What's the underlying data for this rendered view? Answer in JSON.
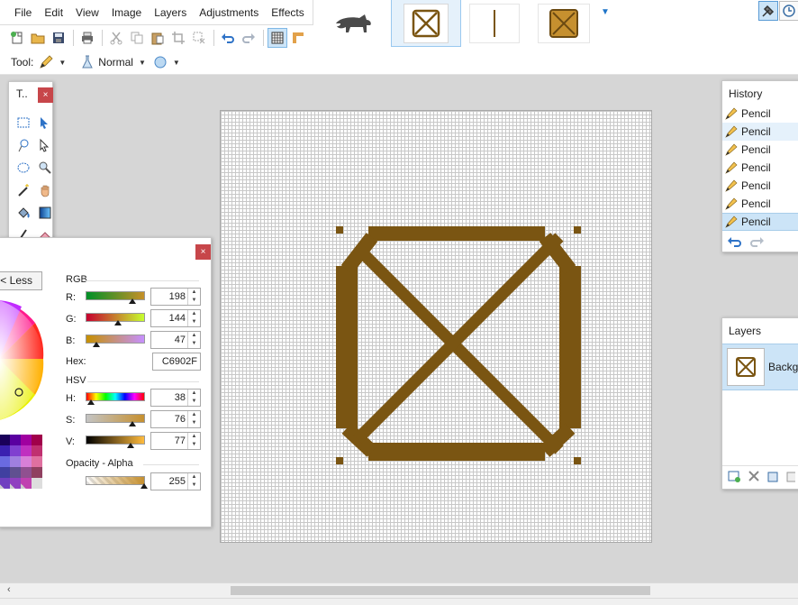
{
  "menu": [
    "File",
    "Edit",
    "View",
    "Image",
    "Layers",
    "Adjustments",
    "Effects"
  ],
  "toolbar": {
    "icons": [
      "new-icon",
      "open-icon",
      "save-icon",
      "print-icon",
      "cut-icon",
      "copy-icon",
      "paste-icon",
      "crop-icon",
      "deselect-icon",
      "undo-icon",
      "redo-icon",
      "grid-icon",
      "ruler-icon"
    ]
  },
  "toolrow": {
    "tool_label": "Tool:",
    "blend_mode": "Normal"
  },
  "tools_panel": {
    "title": "T..",
    "close": "×"
  },
  "colors_panel": {
    "close": "×",
    "less_button": "< Less",
    "rgb_section": "RGB",
    "hsv_section": "HSV",
    "labels": {
      "r": "R:",
      "g": "G:",
      "b": "B:",
      "hex": "Hex:",
      "h": "H:",
      "s": "S:",
      "v": "V:"
    },
    "values": {
      "r": "198",
      "g": "144",
      "b": "47",
      "hex": "C6902F",
      "h": "38",
      "s": "76",
      "v": "77",
      "alpha": "255"
    },
    "opacity_section": "Opacity - Alpha",
    "primary_color": "#C6902F"
  },
  "history_panel": {
    "title": "History",
    "items": [
      "Pencil",
      "Pencil",
      "Pencil",
      "Pencil",
      "Pencil",
      "Pencil",
      "Pencil"
    ],
    "selected_index": 6
  },
  "layers_panel": {
    "title": "Layers",
    "layer_name": "Backgr"
  },
  "drawing": {
    "stroke_color": "#7a5512"
  }
}
